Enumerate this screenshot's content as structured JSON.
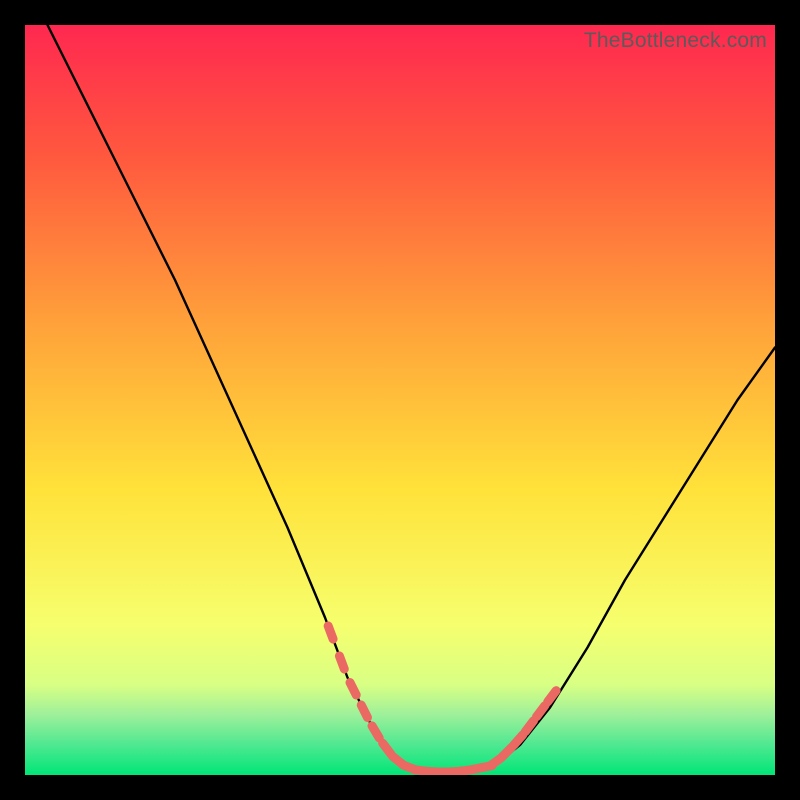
{
  "watermark": "TheBottleneck.com",
  "colors": {
    "background": "#000000",
    "gradient_top": "#ff2850",
    "gradient_mid1": "#ff7a30",
    "gradient_mid2": "#ffe23a",
    "gradient_low": "#f6ff6e",
    "gradient_green_top": "#8cf58c",
    "gradient_bottom": "#00e676",
    "curve": "#000000",
    "highlight": "#ea6a63",
    "watermark_text": "#5b5b5b"
  },
  "chart_data": {
    "type": "line",
    "title": "",
    "xlabel": "",
    "ylabel": "",
    "xlim": [
      0,
      100
    ],
    "ylim": [
      0,
      100
    ],
    "series": [
      {
        "name": "bottleneck-curve-left",
        "x": [
          3,
          6,
          10,
          15,
          20,
          25,
          30,
          35,
          40,
          43,
          46,
          49,
          51.5
        ],
        "y": [
          100,
          94,
          86,
          76,
          66,
          55,
          44,
          33,
          21,
          13,
          7,
          2.5,
          0.7
        ]
      },
      {
        "name": "bottleneck-flat",
        "x": [
          51.5,
          54,
          57,
          60,
          62.5
        ],
        "y": [
          0.7,
          0.4,
          0.4,
          0.7,
          1.2
        ]
      },
      {
        "name": "bottleneck-curve-right",
        "x": [
          62.5,
          66,
          70,
          75,
          80,
          85,
          90,
          95,
          100
        ],
        "y": [
          1.2,
          4,
          9,
          17,
          26,
          34,
          42,
          50,
          57
        ]
      },
      {
        "name": "highlight-left-band",
        "note": "salmon dashed overlay on lower-left slope",
        "x": [
          40,
          41.5,
          43,
          44.5,
          46,
          47.5,
          49,
          50.5,
          52
        ],
        "y": [
          21,
          17,
          13,
          10,
          7,
          4.5,
          2.5,
          1.3,
          0.7
        ]
      },
      {
        "name": "highlight-flat-band",
        "note": "salmon dashed overlay along trough",
        "x": [
          52,
          53.5,
          55,
          56.5,
          58,
          59.5,
          61,
          62
        ],
        "y": [
          0.7,
          0.5,
          0.4,
          0.4,
          0.5,
          0.7,
          1.0,
          1.2
        ]
      },
      {
        "name": "highlight-right-band",
        "note": "salmon dashed overlay on lower-right slope",
        "x": [
          62,
          63.5,
          65,
          66.5,
          68,
          69.5,
          71
        ],
        "y": [
          1.2,
          2.3,
          3.8,
          5.5,
          7.5,
          9.5,
          11.5
        ]
      }
    ]
  }
}
